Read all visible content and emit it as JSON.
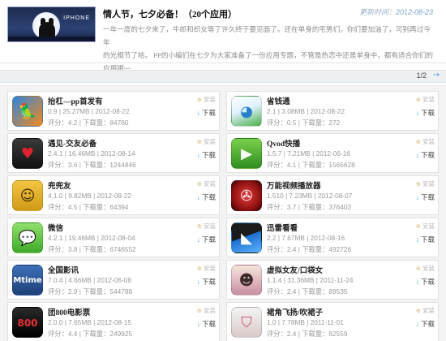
{
  "header": {
    "banner_tag": "IPHONE",
    "title": "情人节，七夕必备！（20个应用）",
    "update_label": "更新时间：",
    "update_value": "2012-08-23",
    "desc_line1": "一年一度的七夕来了，牛郎和织女等了许久终于要见面了。还在单身的宅男们，你们要加油了，可别再过今年",
    "desc_line2": "的光棍节了哈。    PP的小编们在七夕为大家准备了一份应用专题，不管是热恋中还是单身中，都有适合你们的",
    "desc_line3": "应用哦~~"
  },
  "pagination": {
    "label": "1/2",
    "next_icon": "→"
  },
  "colors": {
    "accent": "#3d8fd6",
    "muted_text": "#9a9a9a",
    "border": "#e2e2e2"
  },
  "apps": [
    {
      "name": "抬杠—pp首发有",
      "version": "0.9",
      "size": "25.27MB",
      "date": "2012-08-22",
      "score": "评分：4.2",
      "downloads": "下载量：84780",
      "install": "安装",
      "download": "下载",
      "icon": "parrot-icon"
    },
    {
      "name": "省钱通",
      "version": "2.1",
      "size": "3.08MB",
      "date": "2012-08-22",
      "score": "评分：0.5",
      "downloads": "下载量：272",
      "install": "安装",
      "download": "下载",
      "icon": "leaf-person-icon"
    },
    {
      "name": "遇见-交友必备",
      "version": "2.4.1",
      "size": "16.46MB",
      "date": "2012-08-14",
      "score": "评分：3.6",
      "downloads": "下载量：1244846",
      "install": "安装",
      "download": "下载",
      "icon": "heart-icon"
    },
    {
      "name": "Qvod快播",
      "version": "1.5.7",
      "size": "7.21MB",
      "date": "2012-06-16",
      "score": "评分：4.1",
      "downloads": "下载量：1565628",
      "install": "安装",
      "download": "下载",
      "icon": "play-icon"
    },
    {
      "name": "兜兜友",
      "version": "4.1.0",
      "size": "9.82MB",
      "date": "2012-08-22",
      "score": "评分：4.5",
      "downloads": "下载量：64394",
      "install": "安装",
      "download": "下载",
      "icon": "smiley-icon"
    },
    {
      "name": "万能视频播放器",
      "version": "1.510",
      "size": "7.23MB",
      "date": "2012-08-07",
      "score": "评分：3.7",
      "downloads": "下载量：376402",
      "install": "安装",
      "download": "下载",
      "icon": "film-reel-icon"
    },
    {
      "name": "微信",
      "version": "4.2.1",
      "size": "19.46MB",
      "date": "2012-08-04",
      "score": "评分：3.8",
      "downloads": "下载量：6746552",
      "install": "安装",
      "download": "下载",
      "icon": "chat-bubble-icon"
    },
    {
      "name": "迅雷看看",
      "version": "2.2",
      "size": "7.67MB",
      "date": "2012-08-16",
      "score": "评分：2.4",
      "downloads": "下载量：492726",
      "install": "安装",
      "download": "下载",
      "icon": "clapperboard-icon"
    },
    {
      "name": "全国影讯",
      "version": "7.0.4",
      "size": "4.66MB",
      "date": "2012-06-08",
      "score": "评分：2.9",
      "downloads": "下载量：544788",
      "install": "安装",
      "download": "下载",
      "icon": "mtime-icon"
    },
    {
      "name": "虚拟女友/口袋女",
      "version": "1.1.4",
      "size": "31.36MB",
      "date": "2011-11-24",
      "score": "评分：2.4",
      "downloads": "下载量：89535",
      "install": "安装",
      "download": "下载",
      "icon": "anime-girl-icon"
    },
    {
      "name": "团800电影票",
      "version": "2.0.0",
      "size": "7.65MB",
      "date": "2012-08-15",
      "score": "评分：4.4",
      "downloads": "下载量：249925",
      "install": "安装",
      "download": "下载",
      "icon": "film-ticket-icon"
    },
    {
      "name": "裙角飞扬/吹裙子",
      "version": "1.0",
      "size": "7.78MB",
      "date": "2011-11-01",
      "score": "评分：2.4",
      "downloads": "下载量：82559",
      "install": "安装",
      "download": "下载",
      "icon": "skirt-icon"
    }
  ]
}
